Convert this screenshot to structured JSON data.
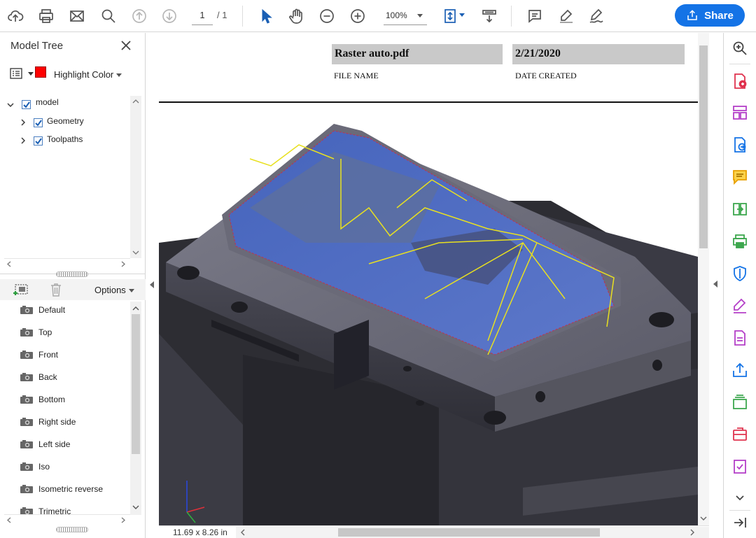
{
  "toolbar": {
    "page_current": "1",
    "page_total": "/ 1",
    "zoom": "100%",
    "share_label": "Share",
    "icons": [
      "upload-cloud-icon",
      "print-icon",
      "email-icon",
      "search-zoom-icon",
      "page-up-icon",
      "page-down-icon",
      "select-arrow-icon",
      "hand-icon",
      "zoom-out-icon",
      "zoom-in-icon",
      "fit-page-icon",
      "scroll-mode-icon",
      "comment-icon",
      "highlight-pen-icon",
      "sign-icon"
    ]
  },
  "model_tree": {
    "title": "Model Tree",
    "highlight_label": "Highlight Color",
    "highlight_color": "#ff0000",
    "nodes": [
      {
        "label": "model",
        "checked": true,
        "expanded": true
      },
      {
        "label": "Geometry",
        "checked": true,
        "expanded": false
      },
      {
        "label": "Toolpaths",
        "checked": true,
        "expanded": false
      }
    ]
  },
  "views": {
    "options_label": "Options",
    "items": [
      "Default",
      "Top",
      "Front",
      "Back",
      "Bottom",
      "Right side",
      "Left side",
      "Iso",
      "Isometric reverse",
      "Trimetric"
    ]
  },
  "document": {
    "file_name": "Raster auto.pdf",
    "file_name_label": "FILE NAME",
    "date_created": "2/21/2020",
    "date_created_label": "DATE CREATED",
    "page_size": "11.69 x 8.26 in"
  },
  "right_tools": {
    "colors": {
      "red": "#e0334f",
      "purple": "#b43fc8",
      "yellow": "#e8a000",
      "green": "#3da74e",
      "blue": "#1473e6",
      "gray": "#555555"
    }
  }
}
